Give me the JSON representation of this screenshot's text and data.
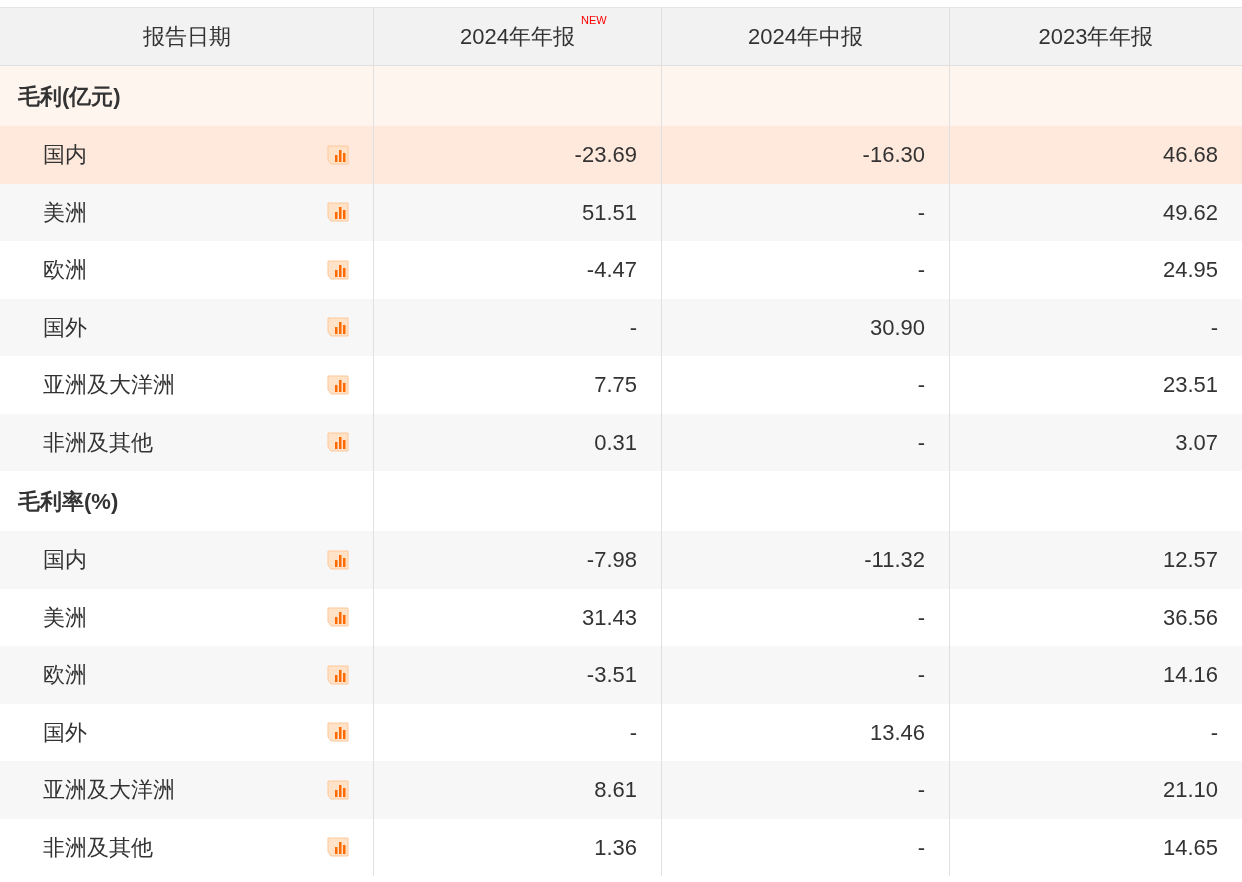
{
  "table": {
    "columns": [
      {
        "label": "报告日期"
      },
      {
        "label": "2024年年报",
        "badge": "NEW"
      },
      {
        "label": "2024年中报"
      },
      {
        "label": "2023年年报"
      }
    ],
    "groups": [
      {
        "title": "毛利(亿元)",
        "highlighted": true,
        "rows": [
          {
            "label": "国内",
            "highlighted": true,
            "values": [
              "-23.69",
              "-16.30",
              "46.68"
            ]
          },
          {
            "label": "美洲",
            "highlighted": false,
            "values": [
              "51.51",
              "-",
              "49.62"
            ]
          },
          {
            "label": "欧洲",
            "highlighted": false,
            "values": [
              "-4.47",
              "-",
              "24.95"
            ]
          },
          {
            "label": "国外",
            "highlighted": false,
            "values": [
              "-",
              "30.90",
              "-"
            ]
          },
          {
            "label": "亚洲及大洋洲",
            "highlighted": false,
            "values": [
              "7.75",
              "-",
              "23.51"
            ]
          },
          {
            "label": "非洲及其他",
            "highlighted": false,
            "values": [
              "0.31",
              "-",
              "3.07"
            ]
          }
        ]
      },
      {
        "title": "毛利率(%)",
        "highlighted": false,
        "rows": [
          {
            "label": "国内",
            "highlighted": false,
            "values": [
              "-7.98",
              "-11.32",
              "12.57"
            ]
          },
          {
            "label": "美洲",
            "highlighted": false,
            "values": [
              "31.43",
              "-",
              "36.56"
            ]
          },
          {
            "label": "欧洲",
            "highlighted": false,
            "values": [
              "-3.51",
              "-",
              "14.16"
            ]
          },
          {
            "label": "国外",
            "highlighted": false,
            "values": [
              "-",
              "13.46",
              "-"
            ]
          },
          {
            "label": "亚洲及大洋洲",
            "highlighted": false,
            "values": [
              "8.61",
              "-",
              "21.10"
            ]
          },
          {
            "label": "非洲及其他",
            "highlighted": false,
            "values": [
              "1.36",
              "-",
              "14.65"
            ]
          }
        ]
      }
    ]
  }
}
